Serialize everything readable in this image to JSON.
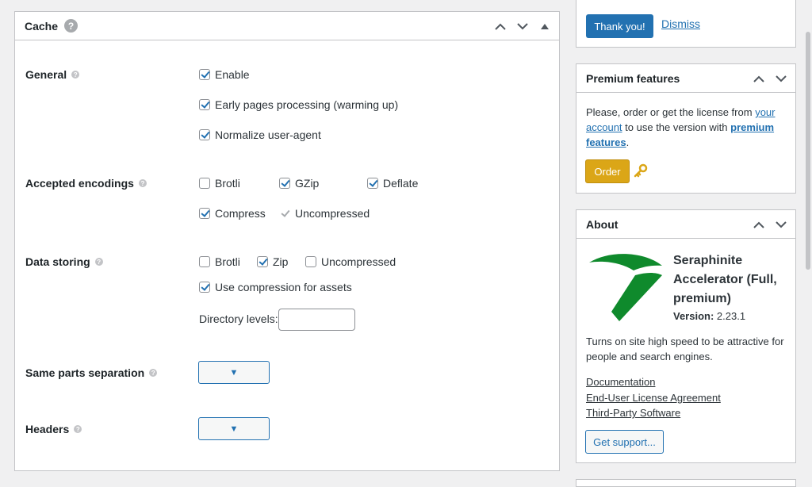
{
  "cache_panel": {
    "title": "Cache",
    "help_glyph": "?",
    "controls": [
      "move-up-icon",
      "move-down-icon",
      "toggle-panel-icon"
    ],
    "general": {
      "label": "General",
      "options": [
        {
          "label": "Enable",
          "checked": true
        },
        {
          "label": "Early pages processing (warming up)",
          "checked": true
        },
        {
          "label": "Normalize user-agent",
          "checked": true
        }
      ]
    },
    "accepted_encodings": {
      "label": "Accepted encodings",
      "options": [
        {
          "label": "Brotli",
          "checked": false
        },
        {
          "label": "GZip",
          "checked": true
        },
        {
          "label": "Deflate",
          "checked": true
        },
        {
          "label": "Compress",
          "checked": true
        },
        {
          "label": "Uncompressed",
          "checked": true,
          "disabled": true
        }
      ]
    },
    "data_storing": {
      "label": "Data storing",
      "options": [
        {
          "label": "Brotli",
          "checked": false
        },
        {
          "label": "Zip",
          "checked": true
        },
        {
          "label": "Uncompressed",
          "checked": false
        },
        {
          "label": "Use compression for assets",
          "checked": true
        }
      ],
      "directory_levels_label": "Directory levels:",
      "directory_levels_value": ""
    },
    "same_parts_separation": {
      "label": "Same parts separation",
      "select_value": ""
    },
    "headers": {
      "label": "Headers",
      "select_value": ""
    }
  },
  "notice_panel": {
    "thank_you_label": "Thank you!",
    "dismiss_label": "Dismiss"
  },
  "premium_panel": {
    "title": "Premium features",
    "text_prefix": "Please, order or get the license from",
    "link_account": "your account",
    "text_middle": "to use the version with",
    "link_premium": "premium features",
    "text_suffix": ".",
    "order_label": "Order"
  },
  "about_panel": {
    "title": "About",
    "product_name": "Seraphinite Accelerator (Full, premium)",
    "version_label": "Version:",
    "version_value": "2.23.1",
    "description": "Turns on site high speed to be attractive for people and search engines.",
    "links": [
      "Documentation",
      "End-User License Agreement",
      "Third-Party Software"
    ],
    "support_label": "Get support..."
  },
  "colors": {
    "accent": "#2271b1",
    "order": "#dba617",
    "logo_green": "#0f8a2c"
  }
}
